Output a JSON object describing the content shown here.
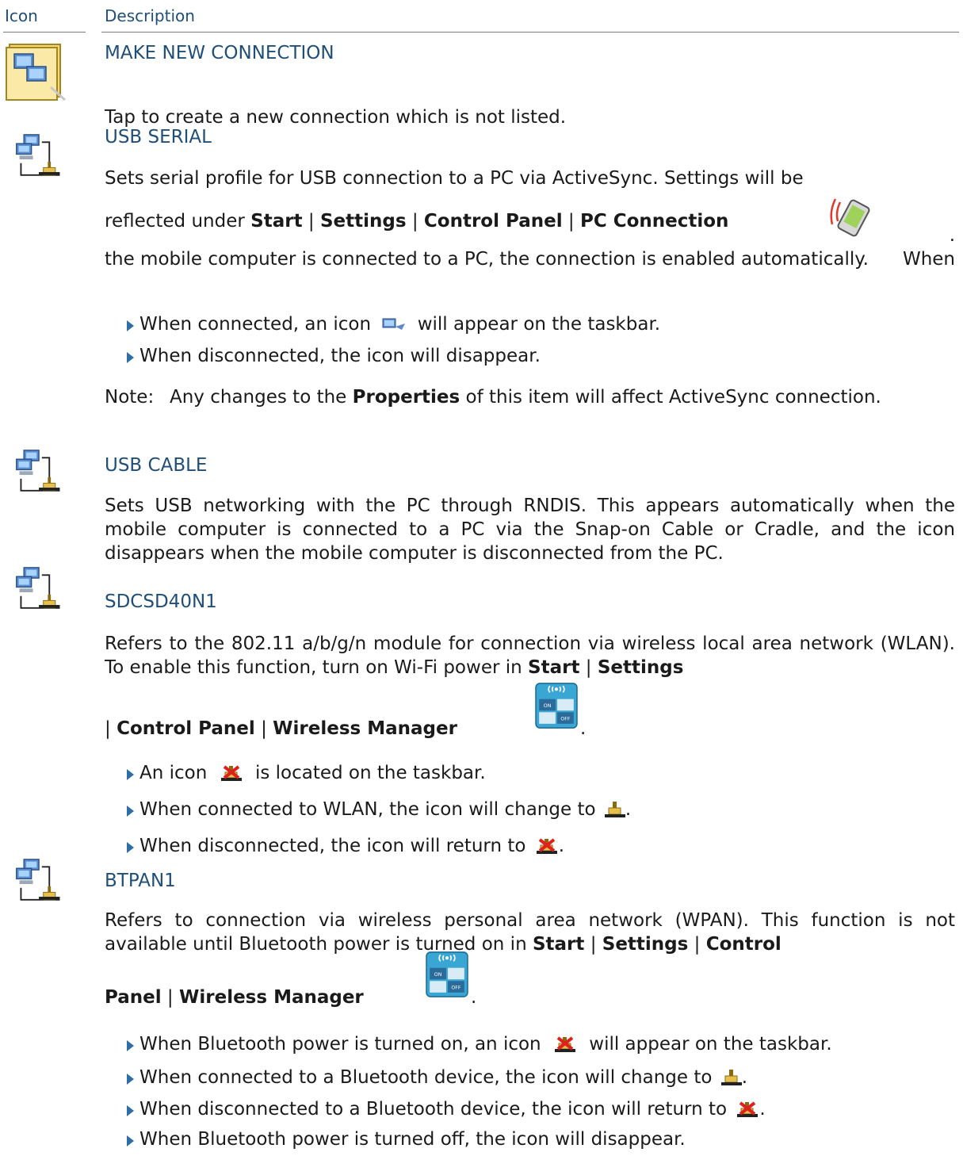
{
  "header": {
    "col_icon": "Icon",
    "col_description": "Description"
  },
  "make_new": {
    "title": "MAKE NEW CONNECTION",
    "desc": "Tap to create a new connection which is not listed."
  },
  "usb_serial": {
    "title": "USB SERIAL",
    "line1": "Sets serial profile for USB connection to a PC via ActiveSync. Settings will be",
    "reflected": "reflected under",
    "start": "Start",
    "settings": "Settings",
    "control_panel": "Control Panel",
    "pc_connection": "PC Connection",
    "when": ". When",
    "rest": "the mobile computer is connected to a PC, the connection is enabled automatically.",
    "bullet1_a": "When connected, an icon",
    "bullet1_b": "will appear on the taskbar.",
    "bullet2": "When disconnected, the icon will disappear.",
    "note_label": "Note:",
    "note_a": "Any changes to the",
    "note_bold": "Properties",
    "note_b": "of this item will affect ActiveSync connection."
  },
  "usb_cable": {
    "title": "USB CABLE",
    "desc": "Sets USB networking with the PC through RNDIS. This appears automatically when the mobile computer is connected to a PC via the Snap-on Cable or Cradle, and the icon disappears when the mobile computer is disconnected from the PC."
  },
  "sdcsd": {
    "title": "SDCSD40N1",
    "desc_a": "Refers to the 802.11 a/b/g/n module for connection via wireless local area network (WLAN). To enable this function, turn on Wi-Fi power in",
    "start": "Start",
    "settings": "Settings",
    "control_panel": "Control Panel",
    "wireless_manager": "Wireless Manager",
    "bullet1_a": "An icon",
    "bullet1_b": "is located on the taskbar.",
    "bullet2": "When connected to WLAN, the icon will change to",
    "bullet3": "When disconnected, the icon will return to"
  },
  "btpan": {
    "title": "BTPAN1",
    "desc_a": "Refers to connection via wireless personal area network (WPAN). This function is not available until Bluetooth power is turned on in",
    "start": "Start",
    "settings": "Settings",
    "control": "Control",
    "panel": "Panel",
    "wireless_manager": "Wireless Manager",
    "bullet1_a": "When Bluetooth power is turned on, an icon",
    "bullet1_b": "will appear on the taskbar.",
    "bullet2": "When connected to a Bluetooth device, the icon will change to",
    "bullet3": "When disconnected to a Bluetooth device, the icon will return to",
    "bullet4": "When Bluetooth power is turned off, the icon will disappear."
  },
  "icons": {
    "make_new": "make-new-connection-icon",
    "network": "network-connection-icon",
    "pc_connection": "pc-connection-icon",
    "activesync": "activesync-taskbar-icon",
    "wireless_manager": "wireless-manager-icon",
    "disconnected": "network-disconnected-icon",
    "connected": "network-connected-icon"
  }
}
